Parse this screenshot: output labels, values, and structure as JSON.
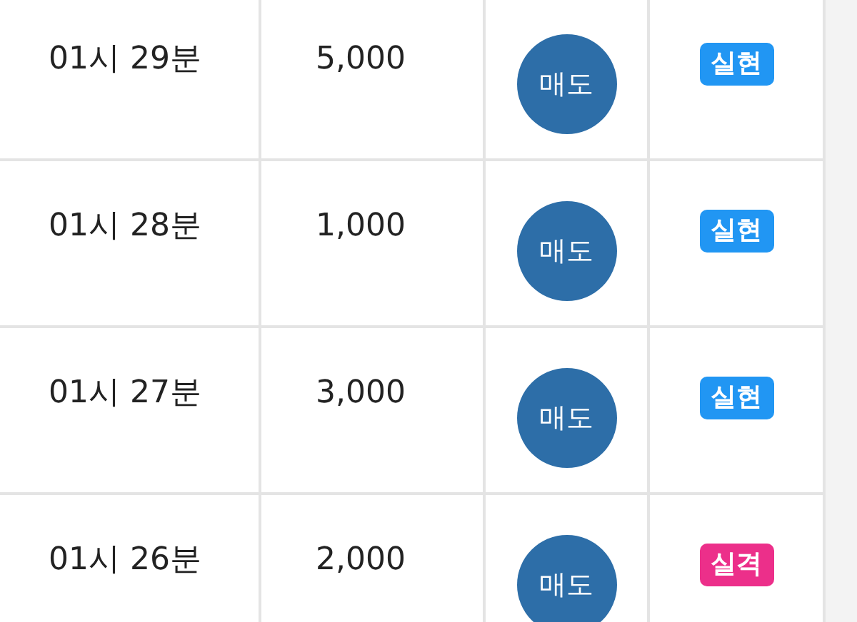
{
  "rows": [
    {
      "time": "01시 29분",
      "amount": "5,000",
      "action": "매도",
      "status": {
        "label": "실현",
        "color": "#2196f3"
      }
    },
    {
      "time": "01시 28분",
      "amount": "1,000",
      "action": "매도",
      "status": {
        "label": "실현",
        "color": "#2196f3"
      }
    },
    {
      "time": "01시 27분",
      "amount": "3,000",
      "action": "매도",
      "status": {
        "label": "실현",
        "color": "#2196f3"
      }
    },
    {
      "time": "01시 26분",
      "amount": "2,000",
      "action": "매도",
      "status": {
        "label": "실격",
        "color": "#ec2f8a"
      }
    }
  ]
}
